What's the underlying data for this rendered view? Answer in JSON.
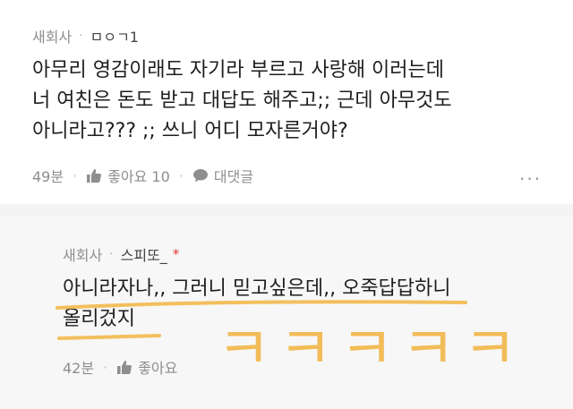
{
  "comments": [
    {
      "author_label": "새회사",
      "nickname": "ㅁㅇㄱ1",
      "lines": [
        "아무리 영감이래도 자기라 부르고 사랑해 이러는데",
        "너 여친은 돈도 받고 대답도 해주고;; 근데 아무것도",
        "아니라고??? ;; 쓰니 어디 모자른거야?"
      ],
      "time": "49분",
      "like_label": "좋아요 10",
      "reply_label": "대댓글",
      "more_label": "···"
    },
    {
      "author_label": "새회사",
      "nickname": "스피또_",
      "star": "*",
      "lines": [
        "아니라자나,,  그러니 믿고싶은데,, 오죽답답하니",
        "올리겄지"
      ],
      "time": "42분",
      "like_label": "좋아요",
      "handwriting": "ㅋㅋㅋㅋㅋ"
    }
  ],
  "colors": {
    "highlight": "#f2b84b",
    "muted": "#8e8e8e",
    "accent_star": "#e03a3a"
  },
  "icons": [
    "thumbs-up-icon",
    "speech-bubble-icon",
    "more-icon"
  ]
}
